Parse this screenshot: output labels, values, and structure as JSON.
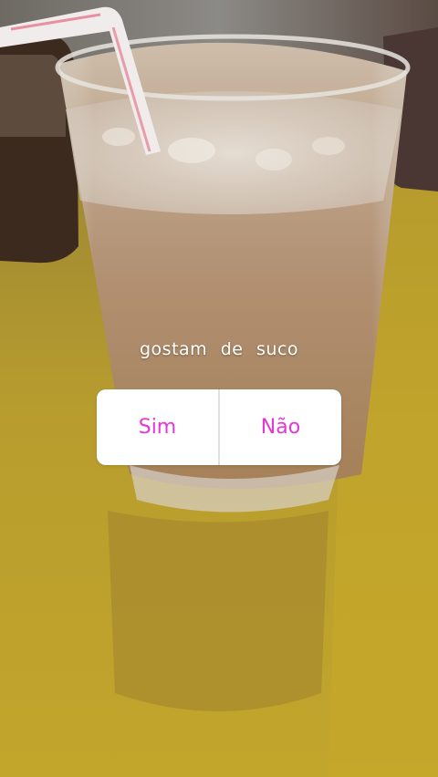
{
  "story": {
    "question": "gostam de suco",
    "poll": {
      "option_yes": "Sim",
      "option_no": "Não",
      "accent_color": "#e635d8"
    }
  }
}
